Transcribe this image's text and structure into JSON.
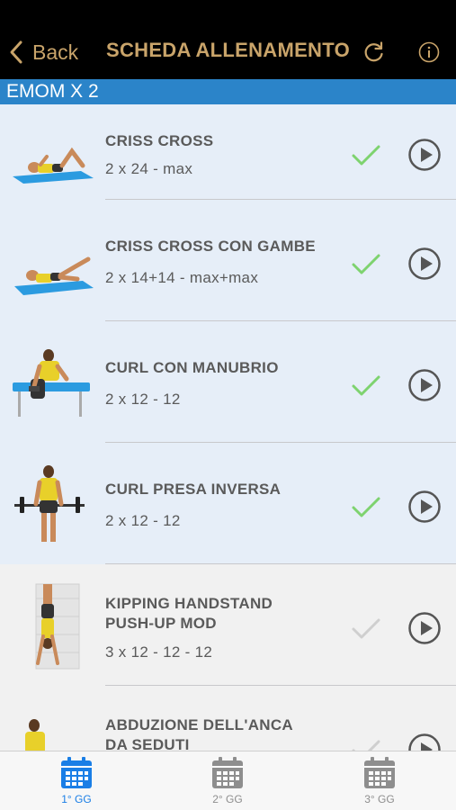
{
  "nav": {
    "back_label": "Back",
    "title": "SCHEDA ALLENAMENTO",
    "accent_color": "#c9a46a"
  },
  "section": {
    "title": "EMOM X 2",
    "color": "#2b84c9"
  },
  "exercises": [
    {
      "name": "CRISS CROSS",
      "sets": "2 x 24 - max",
      "completed": true
    },
    {
      "name": "CRISS CROSS CON GAMBE",
      "sets": "2 x 14+14 - max+max",
      "completed": true
    },
    {
      "name": "CURL CON MANUBRIO",
      "sets": "2 x 12 - 12",
      "completed": true
    },
    {
      "name": "CURL PRESA INVERSA",
      "sets": "2 x 12 - 12",
      "completed": true
    },
    {
      "name_line1": "KIPPING HANDSTAND",
      "name_line2": "PUSH-UP MOD",
      "sets": "3 x 12 - 12 - 12",
      "completed": false
    },
    {
      "name_line1": "ABDUZIONE DELL'ANCA",
      "name_line2": "DA SEDUTI",
      "sets": "",
      "completed": false
    }
  ],
  "tabs": [
    {
      "label": "1° GG",
      "active": true
    },
    {
      "label": "2° GG",
      "active": false
    },
    {
      "label": "3° GG",
      "active": false
    }
  ],
  "colors": {
    "check_done": "#7ed36f",
    "check_pending": "#cfcfcf",
    "tab_active": "#1a7ee6",
    "tab_inactive": "#8e8e8e"
  }
}
